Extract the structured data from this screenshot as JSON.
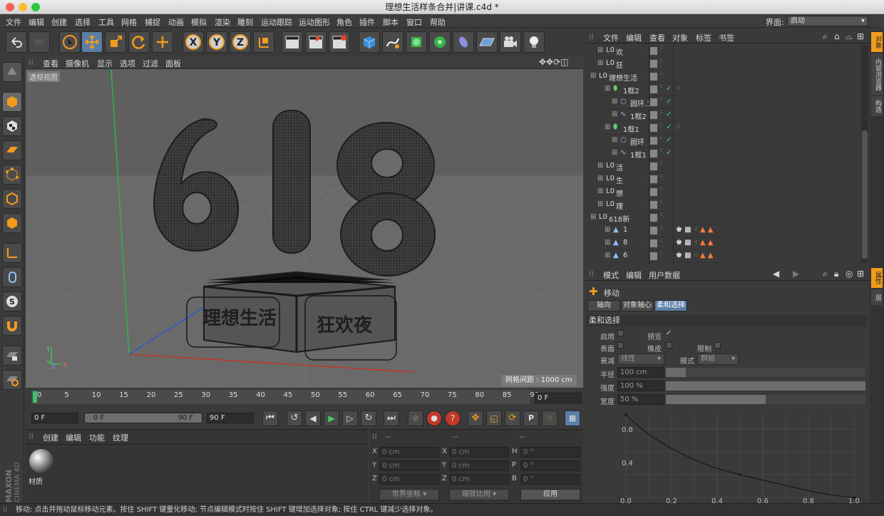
{
  "window": {
    "title": "理想生活样条合并|讲课.c4d *"
  },
  "menu": [
    "文件",
    "编辑",
    "创建",
    "选择",
    "工具",
    "网格",
    "捕捉",
    "动画",
    "模拟",
    "渲染",
    "雕刻",
    "运动跟踪",
    "运动图形",
    "角色",
    "插件",
    "脚本",
    "窗口",
    "帮助"
  ],
  "layout": {
    "label": "界面:",
    "value": "启动"
  },
  "viewport": {
    "menu": [
      "查看",
      "摄像机",
      "显示",
      "选项",
      "过滤",
      "面板"
    ],
    "label": "透视视图",
    "grid_info": "网格间距 : 1000 cm",
    "axis": {
      "y": "Y",
      "z": "Z",
      "x": "X"
    }
  },
  "timeline": {
    "ticks": [
      "0",
      "5",
      "10",
      "15",
      "20",
      "25",
      "30",
      "35",
      "40",
      "45",
      "50",
      "55",
      "60",
      "65",
      "70",
      "75",
      "80",
      "85",
      "90"
    ],
    "current_frame": "0 F"
  },
  "transport": {
    "start": "0 F",
    "range_start": "0 F",
    "range_end": "90 F",
    "end": "90 F"
  },
  "material": {
    "menu": [
      "创建",
      "编辑",
      "功能",
      "纹理"
    ],
    "item": "材质"
  },
  "coords": {
    "headers": [
      "--",
      "--",
      "--"
    ],
    "rows": [
      {
        "a": "X",
        "av": "0 cm",
        "b": "X",
        "bv": "0 cm",
        "c": "H",
        "cv": "0 °"
      },
      {
        "a": "Y",
        "av": "0 cm",
        "b": "Y",
        "bv": "0 cm",
        "c": "P",
        "cv": "0 °"
      },
      {
        "a": "Z",
        "av": "0 cm",
        "b": "Z",
        "bv": "0 cm",
        "c": "B",
        "cv": "0 °"
      }
    ],
    "world": "世界坐标",
    "scale": "缩放比例",
    "apply": "应用"
  },
  "objects": {
    "menu": [
      "文件",
      "编辑",
      "查看",
      "对象",
      "标签",
      "书签"
    ],
    "items": [
      {
        "name": "欢",
        "indent": 0,
        "type": "null"
      },
      {
        "name": "狂",
        "indent": 0,
        "type": "null"
      },
      {
        "name": "理想生活",
        "indent": -1,
        "type": "null"
      },
      {
        "name": "1框2",
        "indent": 1,
        "type": "sweep",
        "check": true,
        "tag": "dots"
      },
      {
        "name": "圆环.1",
        "indent": 2,
        "type": "circle",
        "check": true
      },
      {
        "name": "1框2",
        "indent": 2,
        "type": "spline",
        "check": true
      },
      {
        "name": "1框1",
        "indent": 1,
        "type": "sweep",
        "check": true,
        "tag": "dots"
      },
      {
        "name": "圆环",
        "indent": 2,
        "type": "circle",
        "check": true
      },
      {
        "name": "1框1",
        "indent": 2,
        "type": "spline",
        "check": true
      },
      {
        "name": "活",
        "indent": 0,
        "type": "null"
      },
      {
        "name": "生",
        "indent": 0,
        "type": "null"
      },
      {
        "name": "想",
        "indent": 0,
        "type": "null"
      },
      {
        "name": "理",
        "indent": 0,
        "type": "null"
      },
      {
        "name": "618新",
        "indent": -1,
        "type": "null"
      },
      {
        "name": "1",
        "indent": 1,
        "type": "poly",
        "tag": "multi"
      },
      {
        "name": "8",
        "indent": 1,
        "type": "poly",
        "tag": "multi"
      },
      {
        "name": "6",
        "indent": 1,
        "type": "poly",
        "tag": "multi"
      }
    ]
  },
  "attributes": {
    "menu": [
      "模式",
      "编辑",
      "用户数据"
    ],
    "tool": "移动",
    "tabs": [
      "轴向",
      "对象轴心",
      "柔和选择"
    ],
    "section": "柔和选择",
    "enable": "启用",
    "preview": "预览",
    "preview_check": "✓",
    "surface": "表面",
    "rubber": "橡皮",
    "limit": "限制",
    "falloff_label": "衰减",
    "falloff": "线性",
    "mode_label": "模式",
    "mode": "群組",
    "radius_label": "半径",
    "radius": "100 cm",
    "strength_label": "强度",
    "strength": "100 %",
    "width_label": "宽度",
    "width": "50 %",
    "graph_y": [
      "0.8",
      "0.4",
      "0.0"
    ],
    "graph_x": [
      "0.0",
      "0.2",
      "0.4",
      "0.6",
      "0.8",
      "1.0"
    ],
    "strength_fill": 1.0,
    "width_fill": 0.5
  },
  "side_tabs": [
    "对象",
    "内容浏览器",
    "构造",
    "属性",
    "层"
  ],
  "status": "移动: 点击并拖动鼠标移动元素。按住 SHIFT 键量化移动; 节点编辑模式时按住 SHIFT 键增加选择对象; 按住 CTRL 键减少选择对象。",
  "brand": "MAXON CINEMA 4D",
  "viewport_text": {
    "box_left": "理想生活",
    "box_right": "狂欢夜"
  }
}
